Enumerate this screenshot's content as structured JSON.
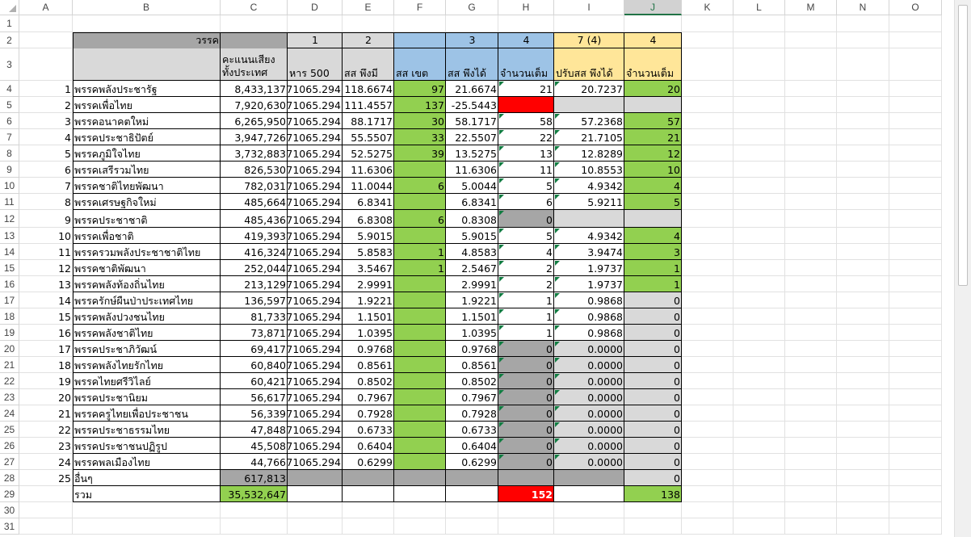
{
  "columns": [
    "A",
    "B",
    "C",
    "D",
    "E",
    "F",
    "G",
    "H",
    "I",
    "J",
    "K",
    "L",
    "M",
    "N",
    "O"
  ],
  "selected_column": "J",
  "row_numbers": [
    "1",
    "2",
    "3",
    "4",
    "5",
    "6",
    "7",
    "8",
    "9",
    "10",
    "11",
    "12",
    "13",
    "14",
    "15",
    "16",
    "17",
    "18",
    "19",
    "20",
    "21",
    "22",
    "23",
    "24",
    "25",
    "26",
    "27",
    "28",
    "29",
    "30",
    "31"
  ],
  "colors": {
    "green": "#92d050",
    "blue": "#9dc3e6",
    "yellow": "#ffe699",
    "gray": "#a6a6a6",
    "lightgray": "#d9d9d9",
    "red": "#ff0000"
  },
  "header_row2": {
    "B": "วรรค",
    "D": "1",
    "E": "2",
    "G": "3",
    "H": "4",
    "I": "7 (4)",
    "J": "4"
  },
  "header_row3": {
    "C_line1": "คะแนนเสียง",
    "C_line2": "ทั้งประเทศ",
    "D": "หาร 500",
    "E": "สส พึงมี",
    "F": "สส เขต",
    "G": "สส พึงได้",
    "H": "จำนวนเต็ม",
    "I": "ปรับสส พึงได้",
    "J": "จำนวนเต็ม"
  },
  "parties": [
    {
      "n": "1",
      "name": "พรรคพลังประชารัฐ",
      "votes": "8,433,137",
      "div": "71065.294",
      "should": "118.6674",
      "district": "97",
      "get": "21.6674",
      "int": "21",
      "adj": "20.7237",
      "int2": "20"
    },
    {
      "n": "2",
      "name": "พรรคเพื่อไทย",
      "votes": "7,920,630",
      "div": "71065.294",
      "should": "111.4557",
      "district": "137",
      "get": "-25.5443",
      "int": "",
      "adj": "",
      "int2": ""
    },
    {
      "n": "3",
      "name": "พรรคอนาคตใหม่",
      "votes": "6,265,950",
      "div": "71065.294",
      "should": "88.1717",
      "district": "30",
      "get": "58.1717",
      "int": "58",
      "adj": "57.2368",
      "int2": "57"
    },
    {
      "n": "4",
      "name": "พรรคประชาธิปัตย์",
      "votes": "3,947,726",
      "div": "71065.294",
      "should": "55.5507",
      "district": "33",
      "get": "22.5507",
      "int": "22",
      "adj": "21.7105",
      "int2": "21"
    },
    {
      "n": "5",
      "name": "พรรคภูมิใจไทย",
      "votes": "3,732,883",
      "div": "71065.294",
      "should": "52.5275",
      "district": "39",
      "get": "13.5275",
      "int": "13",
      "adj": "12.8289",
      "int2": "12"
    },
    {
      "n": "6",
      "name": "พรรคเสรีรวมไทย",
      "votes": "826,530",
      "div": "71065.294",
      "should": "11.6306",
      "district": "",
      "get": "11.6306",
      "int": "11",
      "adj": "10.8553",
      "int2": "10"
    },
    {
      "n": "7",
      "name": "พรรคชาติไทยพัฒนา",
      "votes": "782,031",
      "div": "71065.294",
      "should": "11.0044",
      "district": "6",
      "get": "5.0044",
      "int": "5",
      "adj": "4.9342",
      "int2": "4"
    },
    {
      "n": "8",
      "name": "พรรคเศรษฐกิจใหม่",
      "votes": "485,664",
      "div": "71065.294",
      "should": "6.8341",
      "district": "",
      "get": "6.8341",
      "int": "6",
      "adj": "5.9211",
      "int2": "5"
    },
    {
      "n": "9",
      "name": "พรรคประชาชาติ",
      "votes": "485,436",
      "div": "71065.294",
      "should": "6.8308",
      "district": "6",
      "get": "0.8308",
      "int": "0",
      "adj": "",
      "int2": ""
    },
    {
      "n": "10",
      "name": "พรรคเพื่อชาติ",
      "votes": "419,393",
      "div": "71065.294",
      "should": "5.9015",
      "district": "",
      "get": "5.9015",
      "int": "5",
      "adj": "4.9342",
      "int2": "4"
    },
    {
      "n": "11",
      "name": "พรรครวมพลังประชาชาติไทย",
      "votes": "416,324",
      "div": "71065.294",
      "should": "5.8583",
      "district": "1",
      "get": "4.8583",
      "int": "4",
      "adj": "3.9474",
      "int2": "3"
    },
    {
      "n": "12",
      "name": "พรรคชาติพัฒนา",
      "votes": "252,044",
      "div": "71065.294",
      "should": "3.5467",
      "district": "1",
      "get": "2.5467",
      "int": "2",
      "adj": "1.9737",
      "int2": "1"
    },
    {
      "n": "13",
      "name": "พรรคพลังท้องถิ่นไทย",
      "votes": "213,129",
      "div": "71065.294",
      "should": "2.9991",
      "district": "",
      "get": "2.9991",
      "int": "2",
      "adj": "1.9737",
      "int2": "1"
    },
    {
      "n": "14",
      "name": "พรรครักษ์ผืนป่าประเทศไทย",
      "votes": "136,597",
      "div": "71065.294",
      "should": "1.9221",
      "district": "",
      "get": "1.9221",
      "int": "1",
      "adj": "0.9868",
      "int2": "0"
    },
    {
      "n": "15",
      "name": "พรรคพลังปวงชนไทย",
      "votes": "81,733",
      "div": "71065.294",
      "should": "1.1501",
      "district": "",
      "get": "1.1501",
      "int": "1",
      "adj": "0.9868",
      "int2": "0"
    },
    {
      "n": "16",
      "name": "พรรคพลังชาติไทย",
      "votes": "73,871",
      "div": "71065.294",
      "should": "1.0395",
      "district": "",
      "get": "1.0395",
      "int": "1",
      "adj": "0.9868",
      "int2": "0"
    },
    {
      "n": "17",
      "name": "พรรคประชาภิวัฒน์",
      "votes": "69,417",
      "div": "71065.294",
      "should": "0.9768",
      "district": "",
      "get": "0.9768",
      "int": "0",
      "adj": "0.0000",
      "int2": "0"
    },
    {
      "n": "18",
      "name": "พรรคพลังไทยรักไทย",
      "votes": "60,840",
      "div": "71065.294",
      "should": "0.8561",
      "district": "",
      "get": "0.8561",
      "int": "0",
      "adj": "0.0000",
      "int2": "0"
    },
    {
      "n": "19",
      "name": "พรรคไทยศรีวิไลย์",
      "votes": "60,421",
      "div": "71065.294",
      "should": "0.8502",
      "district": "",
      "get": "0.8502",
      "int": "0",
      "adj": "0.0000",
      "int2": "0"
    },
    {
      "n": "20",
      "name": "พรรคประชานิยม",
      "votes": "56,617",
      "div": "71065.294",
      "should": "0.7967",
      "district": "",
      "get": "0.7967",
      "int": "0",
      "adj": "0.0000",
      "int2": "0"
    },
    {
      "n": "21",
      "name": "พรรคครูไทยเพื่อประชาชน",
      "votes": "56,339",
      "div": "71065.294",
      "should": "0.7928",
      "district": "",
      "get": "0.7928",
      "int": "0",
      "adj": "0.0000",
      "int2": "0"
    },
    {
      "n": "22",
      "name": "พรรคประชาธรรมไทย",
      "votes": "47,848",
      "div": "71065.294",
      "should": "0.6733",
      "district": "",
      "get": "0.6733",
      "int": "0",
      "adj": "0.0000",
      "int2": "0"
    },
    {
      "n": "23",
      "name": "พรรคประชาชนปฏิรูป",
      "votes": "45,508",
      "div": "71065.294",
      "should": "0.6404",
      "district": "",
      "get": "0.6404",
      "int": "0",
      "adj": "0.0000",
      "int2": "0"
    },
    {
      "n": "24",
      "name": "พรรคพลเมืองไทย",
      "votes": "44,766",
      "div": "71065.294",
      "should": "0.6299",
      "district": "",
      "get": "0.6299",
      "int": "0",
      "adj": "0.0000",
      "int2": "0"
    }
  ],
  "other_row": {
    "n": "25",
    "name": "อื่นๆ",
    "votes": "617,813",
    "int2": "0"
  },
  "total_row": {
    "name": "รวม",
    "votes": "35,532,647",
    "int": "152",
    "int2": "138"
  }
}
